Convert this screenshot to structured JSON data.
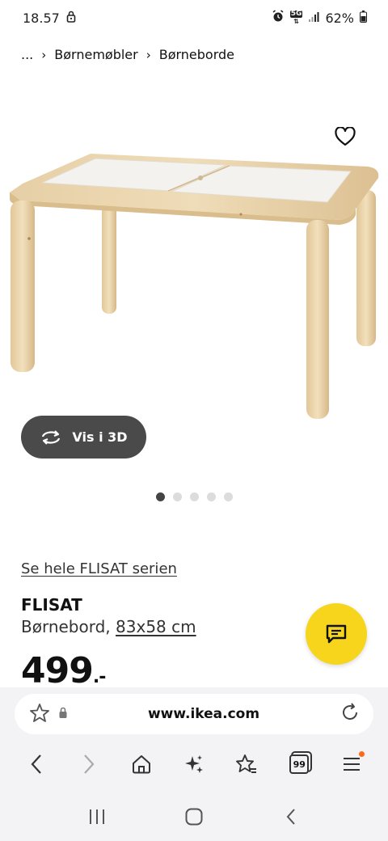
{
  "status_bar": {
    "time": "18.57",
    "network": "5G",
    "battery": "62%"
  },
  "breadcrumb": {
    "ellipsis": "...",
    "items": [
      "Børnemøbler",
      "Børneborde"
    ]
  },
  "product": {
    "view_3d_label": "Vis i 3D",
    "series_link": "Se hele FLISAT serien",
    "name": "FLISAT",
    "description": "Børnebord,",
    "size": "83x58 cm",
    "price": "499",
    "price_suffix": ".-",
    "image_count": 5,
    "active_image": 1
  },
  "browser": {
    "url": "www.ikea.com",
    "tabs_count": "99"
  },
  "colors": {
    "fab_yellow": "#f7d51d",
    "button_dark": "#4a4a4a",
    "notification": "#ff6a1a"
  }
}
